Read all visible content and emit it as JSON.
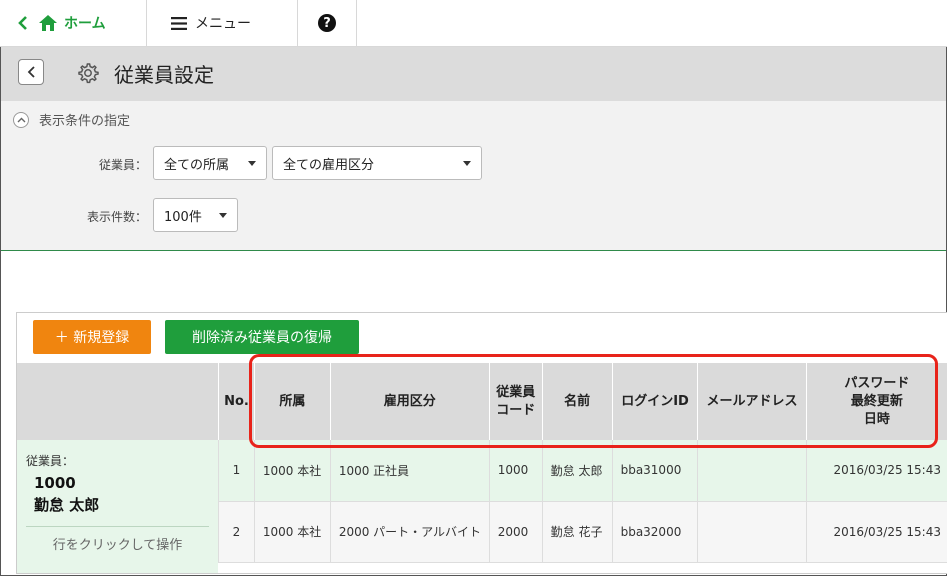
{
  "nav": {
    "home_label": "ホーム",
    "menu_label": "メニュー",
    "help_label": "?"
  },
  "titlebar": {
    "title": "従業員設定"
  },
  "filter": {
    "title": "表示条件の指定",
    "employee_label": "従業員：",
    "department_select": "全ての所属",
    "employment_select": "全ての雇用区分",
    "count_label": "表示件数：",
    "count_select": "100件"
  },
  "actions": {
    "new_label": "＋ 新規登録",
    "restore_label": "削除済み従業員の復帰"
  },
  "selected": {
    "label": "従業員：",
    "code": "1000",
    "name": "勤怠 太郎",
    "hint": "行をクリックして操作"
  },
  "table": {
    "headers": {
      "no": "No.",
      "department": "所属",
      "employment": "雇用区分",
      "code_line1": "従業員",
      "code_line2": "コード",
      "name": "名前",
      "login": "ログインID",
      "email": "メールアドレス",
      "pw_line1": "パスワード",
      "pw_line2": "最終更新",
      "pw_line3": "日時"
    },
    "rows": [
      {
        "no": "1",
        "department": "1000 本社",
        "employment": "1000 正社員",
        "code": "1000",
        "name": "勤怠 太郎",
        "login": "bba31000",
        "email": "",
        "updated": "2016/03/25 15:43"
      },
      {
        "no": "2",
        "department": "1000 本社",
        "employment": "2000 パート・アルバイト",
        "code": "2000",
        "name": "勤怠 花子",
        "login": "bba32000",
        "email": "",
        "updated": "2016/03/25 15:43"
      }
    ]
  },
  "colors": {
    "brand_green": "#1f9e3c",
    "new_button": "#f0850f",
    "highlight": "#e8231a",
    "selected_row": "#e7f6ea"
  }
}
